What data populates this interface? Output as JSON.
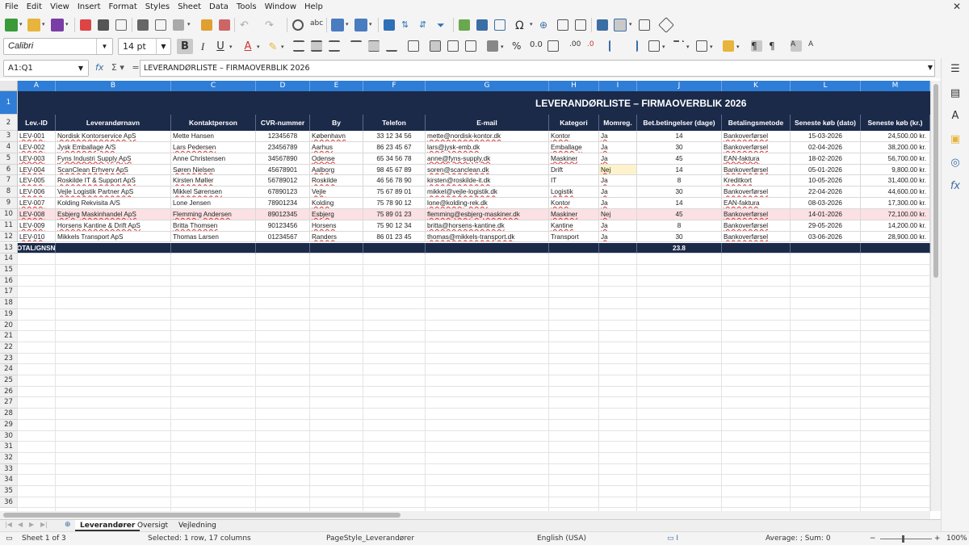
{
  "menu": [
    "File",
    "Edit",
    "View",
    "Insert",
    "Format",
    "Styles",
    "Sheet",
    "Data",
    "Tools",
    "Window",
    "Help"
  ],
  "font": {
    "name": "Calibri",
    "size": "14 pt"
  },
  "formula_bar": {
    "cell_ref": "A1:Q1",
    "content": "LEVERANDØRLISTE – FIRMAOVERBLIK 2026"
  },
  "columns": [
    "A",
    "B",
    "C",
    "D",
    "E",
    "F",
    "G",
    "H",
    "I",
    "J",
    "K",
    "L",
    "M"
  ],
  "title": "LEVERANDØRLISTE – FIRMAOVERBLIK 2026",
  "headers": [
    "Lev.-ID",
    "Leverandørnavn",
    "Kontaktperson",
    "CVR-nummer",
    "By",
    "Telefon",
    "E-mail",
    "Kategori",
    "Momreg.",
    "Bet.betingelser (dage)",
    "Betalingsmetode",
    "Seneste køb (dato)",
    "Seneste køb (kr.)"
  ],
  "rows": [
    [
      "LEV-001",
      "Nordisk Kontorservice ApS",
      "Mette Hansen",
      "12345678",
      "København",
      "33 12 34 56",
      "mette@nordisk-kontor.dk",
      "Kontor",
      "Ja",
      "14",
      "Bankoverførsel",
      "15-03-2026",
      "24,500.00 kr."
    ],
    [
      "LEV-002",
      "Jysk Emballage A/S",
      "Lars Pedersen",
      "23456789",
      "Aarhus",
      "86 23 45 67",
      "lars@jysk-emb.dk",
      "Emballage",
      "Ja",
      "30",
      "Bankoverførsel",
      "02-04-2026",
      "38,200.00 kr."
    ],
    [
      "LEV-003",
      "Fyns Industri Supply ApS",
      "Anne Christensen",
      "34567890",
      "Odense",
      "65 34 56 78",
      "anne@fyns-supply.dk",
      "Maskiner",
      "Ja",
      "45",
      "EAN-faktura",
      "18-02-2026",
      "56,700.00 kr."
    ],
    [
      "LEV-004",
      "ScanClean Erhverv ApS",
      "Søren Nielsen",
      "45678901",
      "Aalborg",
      "98 45 67 89",
      "soren@scanclean.dk",
      "Drift",
      "Nej",
      "14",
      "Bankoverførsel",
      "05-01-2026",
      "9,800.00 kr."
    ],
    [
      "LEV-005",
      "Roskilde IT & Support ApS",
      "Kirsten Møller",
      "56789012",
      "Roskilde",
      "46 56 78 90",
      "kirsten@roskilde-it.dk",
      "IT",
      "Ja",
      "8",
      "Kreditkort",
      "10-05-2026",
      "31,400.00 kr."
    ],
    [
      "LEV-006",
      "Vejle Logistik Partner ApS",
      "Mikkel Sørensen",
      "67890123",
      "Vejle",
      "75 67 89 01",
      "mikkel@vejle-logistik.dk",
      "Logistik",
      "Ja",
      "30",
      "Bankoverførsel",
      "22-04-2026",
      "44,600.00 kr."
    ],
    [
      "LEV-007",
      "Kolding Rekvisita A/S",
      "Lone Jensen",
      "78901234",
      "Kolding",
      "75 78 90 12",
      "lone@kolding-rek.dk",
      "Kontor",
      "Ja",
      "14",
      "EAN-faktura",
      "08-03-2026",
      "17,300.00 kr."
    ],
    [
      "LEV-008",
      "Esbjerg Maskinhandel ApS",
      "Flemming Andersen",
      "89012345",
      "Esbjerg",
      "75 89 01 23",
      "flemming@esbjerg-maskiner.dk",
      "Maskiner",
      "Nej",
      "45",
      "Bankoverførsel",
      "14-01-2026",
      "72,100.00 kr."
    ],
    [
      "LEV-009",
      "Horsens Kantine & Drift ApS",
      "Britta Thomsen",
      "90123456",
      "Horsens",
      "75 90 12 34",
      "britta@horsens-kantine.dk",
      "Kantine",
      "Ja",
      "8",
      "Bankoverførsel",
      "29-05-2026",
      "14,200.00 kr."
    ],
    [
      "LEV-010",
      "Mikkels Transport ApS",
      "Thomas Larsen",
      "01234567",
      "Randers",
      "86 01 23 45",
      "thomas@mikkels-transport.dk",
      "Transport",
      "Ja",
      "30",
      "Bankoverførsel",
      "03-06-2026",
      "28,900.00 kr."
    ]
  ],
  "total_row": {
    "label": "TOTAL/GNSN.",
    "avg_terms": "23.8"
  },
  "sheets": [
    "Leverandører",
    "Oversigt",
    "Vejledning"
  ],
  "status": {
    "sheet": "Sheet 1 of 3",
    "selection": "Selected: 1 row, 17 columns",
    "page_style": "PageStyle_Leverandører",
    "language": "English (USA)",
    "sum": "Average: ; Sum: 0",
    "zoom": "100%"
  },
  "row_numbers": [
    "1",
    "2",
    "3",
    "4",
    "5",
    "6",
    "7",
    "8",
    "9",
    "10",
    "11",
    "12",
    "13",
    "14",
    "15",
    "16",
    "17",
    "18",
    "19",
    "20",
    "21",
    "22",
    "23",
    "24",
    "25",
    "26",
    "27",
    "28",
    "29",
    "30",
    "31",
    "32",
    "33",
    "34",
    "35",
    "36"
  ],
  "colors": {
    "header_bg": "#1b2a49",
    "col_header": "#2e7dd7",
    "highlight_row": "#fbe1e3"
  }
}
